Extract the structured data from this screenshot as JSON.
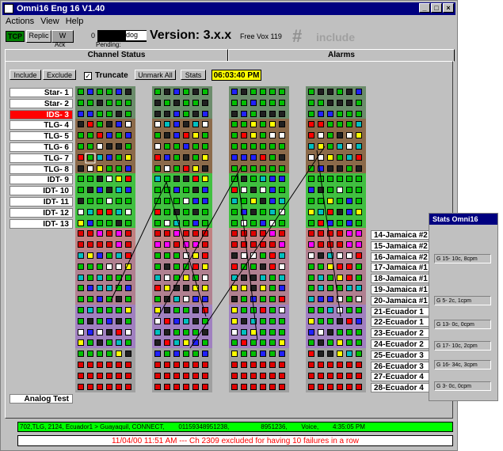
{
  "window": {
    "title": "Omni16  Eng 16 V1.40"
  },
  "menu": [
    "Actions",
    "View",
    "Help"
  ],
  "toolbar": {
    "tcp": "TCP",
    "replic": "Replic",
    "w": "W",
    "ack": "Ack",
    "count": "0",
    "dog": "dog",
    "pending": "Pending:",
    "version": "Version: 3.x.x",
    "freevox": "Free Vox 119",
    "logo": "include"
  },
  "tabs": [
    "Channel Status",
    "Alarms"
  ],
  "controls": {
    "include": "Include",
    "exclude": "Exclude",
    "truncate": "Truncate",
    "unmark_all": "Unmark All",
    "stats": "Stats",
    "clock": "06:03:40 PM"
  },
  "left_labels": [
    "Star- 1",
    "Star- 2",
    "IDS- 3",
    "TLG- 4",
    "TLG- 5",
    "TLG- 6",
    "TLG- 7",
    "TLG- 8",
    "IDT- 9",
    "IDT- 10",
    "IDT- 11",
    "IDT- 12",
    "IDT- 13"
  ],
  "right_labels": [
    "14-Jamaica #2",
    "15-Jamaica #2",
    "16-Jamaica #2",
    "17-Jamaica #1",
    "18-Jamaica #1",
    "19-Jamaica #1",
    "20-Jamaica #1",
    "21-Ecuador 1",
    "22-Ecuador 1",
    "23-Ecuador 2",
    "24-Ecuador 2",
    "25-Ecuador 3",
    "26-Ecuador 3",
    "27-Ecuador 4",
    "28-Ecuador 4"
  ],
  "analog": "Analog Test",
  "stats": {
    "title": "Stats Omni16",
    "items": [
      "G 15- 10c, 8cpm",
      "G 5- 2c, 1cpm",
      "G 13- 0c, 0cpm",
      "G 17- 10c, 2cpm",
      "G 16- 34c, 3cpm",
      "G 3- 0c, 0cpm"
    ]
  },
  "status_line": "702,TLG, 2124, Ecuador1 > Guayaquil, CONNECT,        01159348951238,                  8951236,        Voice,        4:35:05 PM",
  "message": "11/04/00 11:51 AM --- Ch 2309 excluded for having 10 failures in a row",
  "colors": {
    "title_bar": "#000080",
    "status_green": "#00ff00",
    "clock_yellow": "#ffff00",
    "alert_red": "#ff0000"
  }
}
